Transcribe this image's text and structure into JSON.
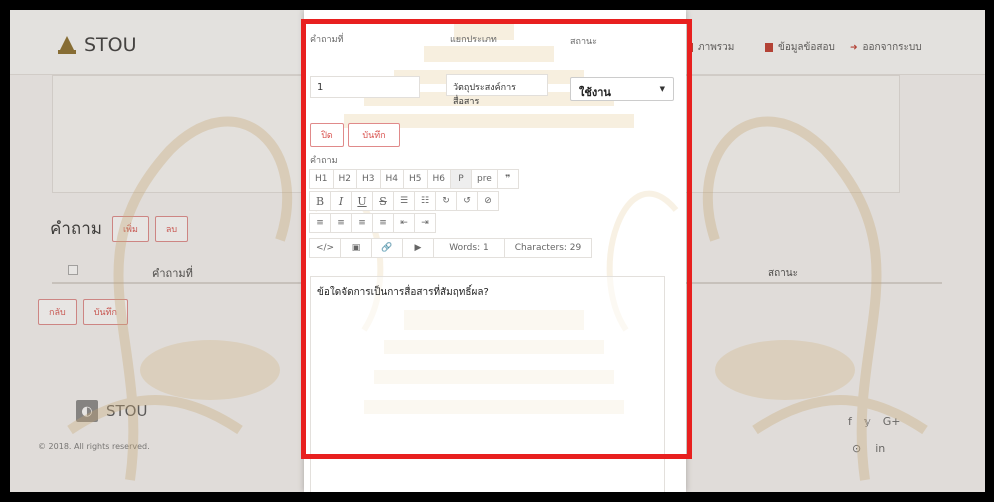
{
  "header": {
    "brand": "STOU",
    "nav": [
      {
        "label": "ภาพรวม",
        "icon": "chart-icon"
      },
      {
        "label": "ข้อมูลข้อสอบ",
        "icon": "book-icon"
      },
      {
        "label": "ออกจากระบบ",
        "icon": "logout-icon"
      }
    ]
  },
  "questions": {
    "title": "คำถาม",
    "add_label": "เพิ่ม",
    "delete_label": "ลบ",
    "col_number": "คำถามที่",
    "col_status": "สถานะ"
  },
  "page_actions": {
    "back_label": "กลับ",
    "save_label": "บันทึก"
  },
  "footer": {
    "brand": "STOU",
    "copyright": "© 2018. All rights reserved.",
    "social": [
      "f",
      "𝕪",
      "G+",
      "⊙",
      "in"
    ]
  },
  "modal": {
    "number_label": "คำถามที่",
    "number_value": "1",
    "category_label": "แยกประเภท",
    "category_value": "วัตถุประสงค์การสื่อสาร",
    "status_label": "สถานะ",
    "status_value": "ใช้งาน",
    "close_label": "ปิด",
    "save_label": "บันทึก",
    "question_label": "คำถาม",
    "toolbar_row1": [
      "H1",
      "H2",
      "H3",
      "H4",
      "H5",
      "H6",
      "P",
      "pre",
      "❞"
    ],
    "toolbar_row2": [
      "B",
      "I",
      "U",
      "S",
      "☰",
      "☷",
      "↻",
      "↺",
      "⊘"
    ],
    "toolbar_row3": [
      "≡",
      "≡",
      "≡",
      "≡",
      "⇤",
      "⇥"
    ],
    "toolbar_row4": [
      "</>",
      "▣",
      "🔗",
      "▶"
    ],
    "words_label": "Words: 1",
    "chars_label": "Characters: 29",
    "question_text": "ข้อใดจัดการเป็นการสื่อสารที่สัมฤทธิ์ผล?"
  },
  "colors": {
    "highlight": "#e8201f",
    "button_red": "#d9534f"
  }
}
